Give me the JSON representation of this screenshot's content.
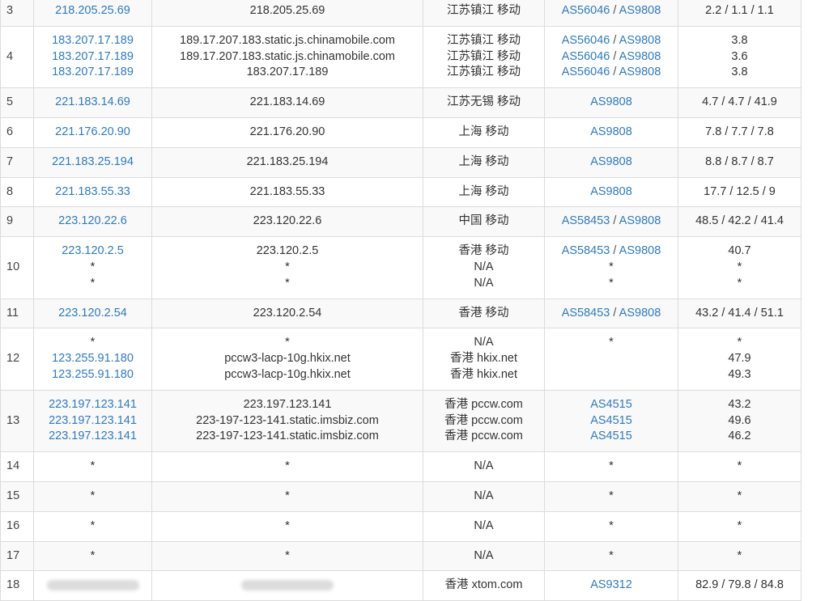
{
  "rows": [
    {
      "hop": "3",
      "ips": [
        "218.205.25.69"
      ],
      "hosts": [
        "218.205.25.69"
      ],
      "locs": [
        "江苏镇江 移动"
      ],
      "as": [
        [
          "AS56046",
          "AS9808"
        ]
      ],
      "rtt": [
        "2.2 / 1.1 / 1.1"
      ]
    },
    {
      "hop": "4",
      "ips": [
        "183.207.17.189",
        "183.207.17.189",
        "183.207.17.189"
      ],
      "hosts": [
        "189.17.207.183.static.js.chinamobile.com",
        "189.17.207.183.static.js.chinamobile.com",
        "183.207.17.189"
      ],
      "locs": [
        "江苏镇江 移动",
        "江苏镇江 移动",
        "江苏镇江 移动"
      ],
      "as": [
        [
          "AS56046",
          "AS9808"
        ],
        [
          "AS56046",
          "AS9808"
        ],
        [
          "AS56046",
          "AS9808"
        ]
      ],
      "rtt": [
        "3.8",
        "3.6",
        "3.8"
      ]
    },
    {
      "hop": "5",
      "ips": [
        "221.183.14.69"
      ],
      "hosts": [
        "221.183.14.69"
      ],
      "locs": [
        "江苏无锡 移动"
      ],
      "as": [
        [
          "AS9808"
        ]
      ],
      "rtt": [
        "4.7 / 4.7 / 41.9"
      ]
    },
    {
      "hop": "6",
      "ips": [
        "221.176.20.90"
      ],
      "hosts": [
        "221.176.20.90"
      ],
      "locs": [
        "上海 移动"
      ],
      "as": [
        [
          "AS9808"
        ]
      ],
      "rtt": [
        "7.8 / 7.7 / 7.8"
      ]
    },
    {
      "hop": "7",
      "ips": [
        "221.183.25.194"
      ],
      "hosts": [
        "221.183.25.194"
      ],
      "locs": [
        "上海 移动"
      ],
      "as": [
        [
          "AS9808"
        ]
      ],
      "rtt": [
        "8.8 / 8.7 / 8.7"
      ]
    },
    {
      "hop": "8",
      "ips": [
        "221.183.55.33"
      ],
      "hosts": [
        "221.183.55.33"
      ],
      "locs": [
        "上海 移动"
      ],
      "as": [
        [
          "AS9808"
        ]
      ],
      "rtt": [
        "17.7 / 12.5 / 9"
      ]
    },
    {
      "hop": "9",
      "ips": [
        "223.120.22.6"
      ],
      "hosts": [
        "223.120.22.6"
      ],
      "locs": [
        "中国 移动"
      ],
      "as": [
        [
          "AS58453",
          "AS9808"
        ]
      ],
      "rtt": [
        "48.5 / 42.2 / 41.4"
      ]
    },
    {
      "hop": "10",
      "ips": [
        "223.120.2.5",
        "*",
        "*"
      ],
      "hosts": [
        "223.120.2.5",
        "*",
        "*"
      ],
      "locs": [
        "香港 移动",
        "N/A",
        "N/A"
      ],
      "as": [
        [
          "AS58453",
          "AS9808"
        ],
        [
          "*"
        ],
        [
          "*"
        ]
      ],
      "rtt": [
        "40.7",
        "*",
        "*"
      ]
    },
    {
      "hop": "11",
      "ips": [
        "223.120.2.54"
      ],
      "hosts": [
        "223.120.2.54"
      ],
      "locs": [
        "香港 移动"
      ],
      "as": [
        [
          "AS58453",
          "AS9808"
        ]
      ],
      "rtt": [
        "43.2 / 41.4 / 51.1"
      ]
    },
    {
      "hop": "12",
      "ips": [
        "*",
        "123.255.91.180",
        "123.255.91.180"
      ],
      "hosts": [
        "*",
        "pccw3-lacp-10g.hkix.net",
        "pccw3-lacp-10g.hkix.net"
      ],
      "locs": [
        "N/A",
        "香港 hkix.net",
        "香港 hkix.net"
      ],
      "as": [
        [
          "*"
        ],
        [],
        []
      ],
      "rtt": [
        "*",
        "47.9",
        "49.3"
      ]
    },
    {
      "hop": "13",
      "ips": [
        "223.197.123.141",
        "223.197.123.141",
        "223.197.123.141"
      ],
      "hosts": [
        "223.197.123.141",
        "223-197-123-141.static.imsbiz.com",
        "223-197-123-141.static.imsbiz.com"
      ],
      "locs": [
        "香港 pccw.com",
        "香港 pccw.com",
        "香港 pccw.com"
      ],
      "as": [
        [
          "AS4515"
        ],
        [
          "AS4515"
        ],
        [
          "AS4515"
        ]
      ],
      "rtt": [
        "43.2",
        "49.6",
        "46.2"
      ]
    },
    {
      "hop": "14",
      "ips": [
        "*"
      ],
      "hosts": [
        "*"
      ],
      "locs": [
        "N/A"
      ],
      "as": [
        [
          "*"
        ]
      ],
      "rtt": [
        "*"
      ]
    },
    {
      "hop": "15",
      "ips": [
        "*"
      ],
      "hosts": [
        "*"
      ],
      "locs": [
        "N/A"
      ],
      "as": [
        [
          "*"
        ]
      ],
      "rtt": [
        "*"
      ]
    },
    {
      "hop": "16",
      "ips": [
        "*"
      ],
      "hosts": [
        "*"
      ],
      "locs": [
        "N/A"
      ],
      "as": [
        [
          "*"
        ]
      ],
      "rtt": [
        "*"
      ]
    },
    {
      "hop": "17",
      "ips": [
        "*"
      ],
      "hosts": [
        "*"
      ],
      "locs": [
        "N/A"
      ],
      "as": [
        [
          "*"
        ]
      ],
      "rtt": [
        "*"
      ]
    },
    {
      "hop": "18",
      "ips": [
        "[redacted]"
      ],
      "hosts": [
        "[redacted]"
      ],
      "locs": [
        "香港 xtom.com"
      ],
      "as": [
        [
          "AS9312"
        ]
      ],
      "rtt": [
        "82.9 / 79.8 / 84.8"
      ]
    }
  ],
  "colors": {
    "link": "#337ab7",
    "text": "#333333",
    "border": "#dcdcdc",
    "row_alt": "#f9f9f9"
  }
}
